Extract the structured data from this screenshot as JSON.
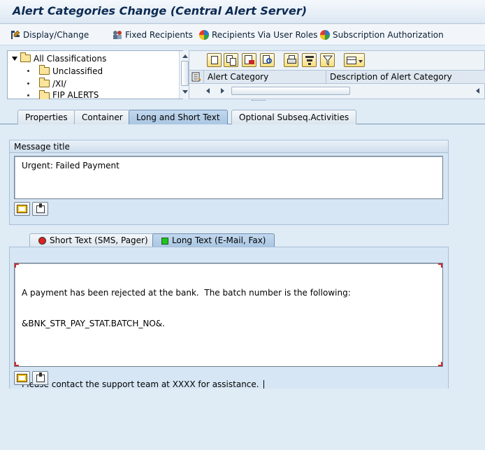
{
  "window": {
    "title": "Alert Categories Change (Central Alert Server)"
  },
  "toolbar": {
    "display_change": "Display/Change",
    "fixed_recipients": "Fixed Recipients",
    "recipients_via_user_roles": "Recipients Via User Roles",
    "subscription_authorization": "Subscription Authorization"
  },
  "tree": {
    "root": "All Classifications",
    "items": [
      "Unclassified",
      "/XI/",
      "FIP ALERTS"
    ]
  },
  "grid": {
    "columns": [
      "Alert Category",
      "Description of Alert Category"
    ]
  },
  "tabs": [
    "Properties",
    "Container",
    "Long and Short Text",
    "Optional Subseq.Activities"
  ],
  "active_tab": "Long and Short Text",
  "message_title": {
    "label": "Message title",
    "value": "Urgent: Failed Payment"
  },
  "text_tabs": [
    {
      "label": "Short Text (SMS, Pager)",
      "status_color": "#e12020"
    },
    {
      "label": "Long Text (E-Mail, Fax)",
      "status_color": "#1fc41f"
    }
  ],
  "long_text": {
    "line1": "A payment has been rejected at the bank.  The batch number is the following:",
    "line2": "&BNK_STR_PAY_STAT.BATCH_NO&.",
    "line3": "",
    "line4": "Please contact the support team at XXXX for assistance."
  },
  "colors": {
    "accent": "#0c2a52",
    "tab_active": "#a9c6e2"
  }
}
